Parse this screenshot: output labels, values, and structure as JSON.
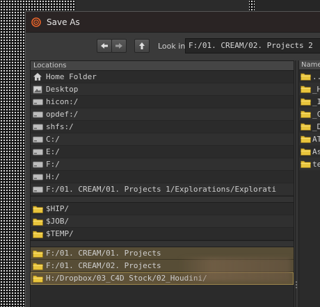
{
  "dialog": {
    "title": "Save As",
    "lookin_label": "Look in",
    "path_value": "F:/01. CREAM/02. Projects 2"
  },
  "locations": {
    "header": "Locations",
    "drives": [
      {
        "label": "Home Folder",
        "icon": "home-icon"
      },
      {
        "label": "Desktop",
        "icon": "desktop-icon"
      },
      {
        "label": "hicon:/",
        "icon": "drive-icon"
      },
      {
        "label": "opdef:/",
        "icon": "drive-icon"
      },
      {
        "label": "shfs:/",
        "icon": "drive-icon"
      },
      {
        "label": "C:/",
        "icon": "drive-icon"
      },
      {
        "label": "E:/",
        "icon": "drive-icon"
      },
      {
        "label": "F:/",
        "icon": "drive-icon"
      },
      {
        "label": "H:/",
        "icon": "drive-icon"
      },
      {
        "label": "F:/01. CREAM/01. Projects 1/Explorations/Explorati",
        "icon": "drive-icon"
      }
    ],
    "variables": [
      {
        "label": "$HIP/",
        "icon": "folder-icon"
      },
      {
        "label": "$JOB/",
        "icon": "folder-icon"
      },
      {
        "label": "$TEMP/",
        "icon": "folder-icon"
      }
    ],
    "favorites": [
      {
        "label": "F:/01. CREAM/01. Projects",
        "icon": "folder-icon"
      },
      {
        "label": "F:/01. CREAM/02. Projects",
        "icon": "folder-icon"
      },
      {
        "label": "H:/Dropbox/03_C4D Stock/02_Houdini/",
        "icon": "folder-icon"
      }
    ]
  },
  "files": {
    "header": "Name",
    "items": [
      {
        "label": "..",
        "icon": "folder-icon"
      },
      {
        "label": "_H",
        "icon": "folder-icon"
      },
      {
        "label": "_I",
        "icon": "folder-icon"
      },
      {
        "label": "_C",
        "icon": "folder-icon"
      },
      {
        "label": "_D",
        "icon": "folder-icon"
      },
      {
        "label": "AT",
        "icon": "folder-icon"
      },
      {
        "label": "As",
        "icon": "folder-icon"
      },
      {
        "label": "te",
        "icon": "folder-icon"
      }
    ]
  },
  "colors": {
    "folder": "#e8c43c",
    "drive": "#bdbdbd",
    "favorite_highlight": "#574d36",
    "houdini_logo": "#e8642a"
  }
}
